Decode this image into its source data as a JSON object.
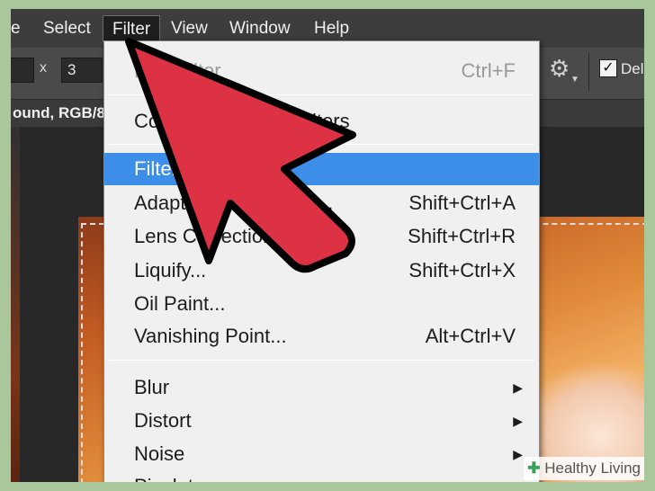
{
  "menubar": {
    "items": [
      "e",
      "Select",
      "Filter",
      "View",
      "Window",
      "Help"
    ]
  },
  "optbar": {
    "field1": "",
    "x_label": "x",
    "field2": "3",
    "checkbox_label": "Del"
  },
  "document": {
    "tab_label": "ound, RGB/8"
  },
  "filter_menu": {
    "last_filter": {
      "label": "Last Filter",
      "shortcut": "Ctrl+F"
    },
    "convert": {
      "label": "Convert for Smart Filters"
    },
    "filter_gallery": {
      "label": "Filter Gallery..."
    },
    "adaptive_wide_angle": {
      "label": "Adaptive Wide Angle...",
      "shortcut": "Shift+Ctrl+A"
    },
    "lens_correction": {
      "label": "Lens Correction...",
      "shortcut": "Shift+Ctrl+R"
    },
    "liquify": {
      "label": "Liquify...",
      "shortcut": "Shift+Ctrl+X"
    },
    "oil_paint": {
      "label": "Oil Paint..."
    },
    "vanishing_point": {
      "label": "Vanishing Point...",
      "shortcut": "Alt+Ctrl+V"
    },
    "blur": {
      "label": "Blur"
    },
    "distort": {
      "label": "Distort"
    },
    "noise": {
      "label": "Noise"
    },
    "pixelate": {
      "label": "Pixelate"
    }
  },
  "overlay": {
    "arrow_color": "#dc3244",
    "arrow_outline": "#000000"
  },
  "watermark": {
    "icon": "plus-leaf-icon",
    "text": "Healthy Living"
  }
}
